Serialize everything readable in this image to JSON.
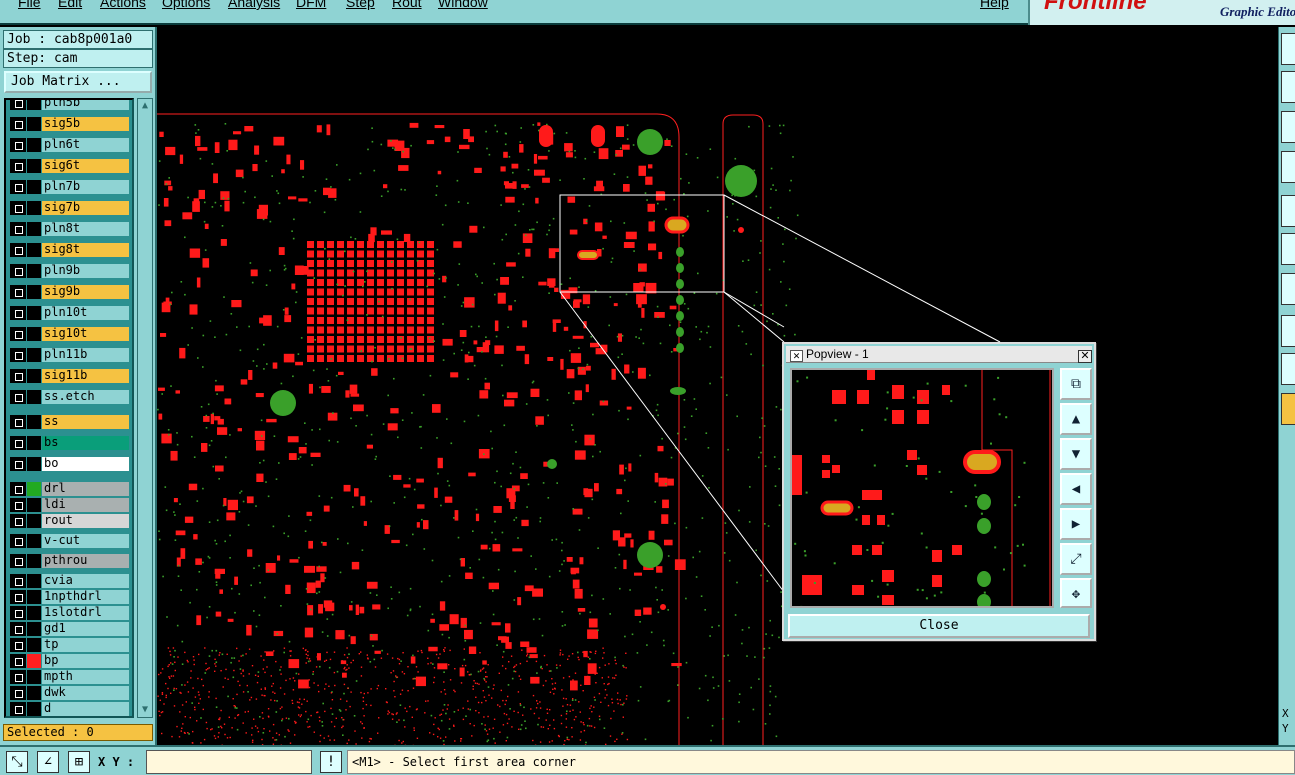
{
  "menu": [
    "File",
    "Edit",
    "Actions",
    "Options",
    "Analysis",
    "DFM",
    "Step",
    "Rout",
    "Window",
    "Help"
  ],
  "brand": {
    "name": "Frontline",
    "subtitle": "Graphic Editor"
  },
  "job": {
    "job_line": "Job : cab8p001a0",
    "step_line": "Step: cam",
    "job_matrix_label": "Job Matrix ..."
  },
  "layers": [
    {
      "name": "pln5b",
      "color": "#8fd3d3",
      "swatch": "#000000"
    },
    {
      "name": "sig5b",
      "color": "#f5c242",
      "swatch": "#000000"
    },
    {
      "name": "pln6t",
      "color": "#8fd3d3",
      "swatch": "#000000"
    },
    {
      "name": "sig6t",
      "color": "#f5c242",
      "swatch": "#000000"
    },
    {
      "name": "pln7b",
      "color": "#8fd3d3",
      "swatch": "#000000"
    },
    {
      "name": "sig7b",
      "color": "#f5c242",
      "swatch": "#000000"
    },
    {
      "name": "pln8t",
      "color": "#8fd3d3",
      "swatch": "#000000"
    },
    {
      "name": "sig8t",
      "color": "#f5c242",
      "swatch": "#000000"
    },
    {
      "name": "pln9b",
      "color": "#8fd3d3",
      "swatch": "#000000"
    },
    {
      "name": "sig9b",
      "color": "#f5c242",
      "swatch": "#000000"
    },
    {
      "name": "pln10t",
      "color": "#8fd3d3",
      "swatch": "#000000"
    },
    {
      "name": "sig10t",
      "color": "#f5c242",
      "swatch": "#000000"
    },
    {
      "name": "pln11b",
      "color": "#8fd3d3",
      "swatch": "#000000"
    },
    {
      "name": "sig11b",
      "color": "#f5c242",
      "swatch": "#000000"
    },
    {
      "name": "ss.etch",
      "color": "#8fd3d3",
      "swatch": "#000000"
    },
    {
      "name": "ss",
      "color": "#f5c242",
      "swatch": "#000000"
    },
    {
      "name": "bs",
      "color": "#0a9e7a",
      "swatch": "#000000"
    },
    {
      "name": "bo",
      "color": "#ffffff",
      "swatch": "#000000"
    },
    {
      "name": "drl",
      "color": "#a9b0b0",
      "swatch": "#22aa22"
    },
    {
      "name": "ldi",
      "color": "#a9b0b0",
      "swatch": "#000000"
    },
    {
      "name": "rout",
      "color": "#d6d6d6",
      "swatch": "#000000"
    },
    {
      "name": "v-cut",
      "color": "#8fd3d3",
      "swatch": "#000000"
    },
    {
      "name": "pthrou",
      "color": "#a9b0b0",
      "swatch": "#000000"
    },
    {
      "name": "cvia",
      "color": "#8fd3d3",
      "swatch": "#000000"
    },
    {
      "name": "1npthdrl",
      "color": "#8fd3d3",
      "swatch": "#000000"
    },
    {
      "name": "1slotdrl",
      "color": "#8fd3d3",
      "swatch": "#000000"
    },
    {
      "name": "gd1",
      "color": "#8fd3d3",
      "swatch": "#000000"
    },
    {
      "name": "tp",
      "color": "#8fd3d3",
      "swatch": "#000000"
    },
    {
      "name": "bp",
      "color": "#8fd3d3",
      "swatch": "#ff2020"
    },
    {
      "name": "mpth",
      "color": "#8fd3d3",
      "swatch": "#000000"
    },
    {
      "name": "dwk",
      "color": "#8fd3d3",
      "swatch": "#000000"
    },
    {
      "name": "d",
      "color": "#8fd3d3",
      "swatch": "#000000"
    }
  ],
  "status": {
    "selected": "Selected : 0",
    "xy_label": "X Y :",
    "xy_value": "",
    "message": "<M1> - Select first area corner"
  },
  "right_toolbar": {
    "x_label": "X",
    "y_label": "Y"
  },
  "popview": {
    "title": "Popview - 1",
    "close_label": "Close"
  },
  "colors": {
    "pad": "#ff1a1a",
    "via": "#3aa02a",
    "outline": "#ff2020",
    "yellow_pad": "#d9a820",
    "panel": "#8fd3d3"
  }
}
